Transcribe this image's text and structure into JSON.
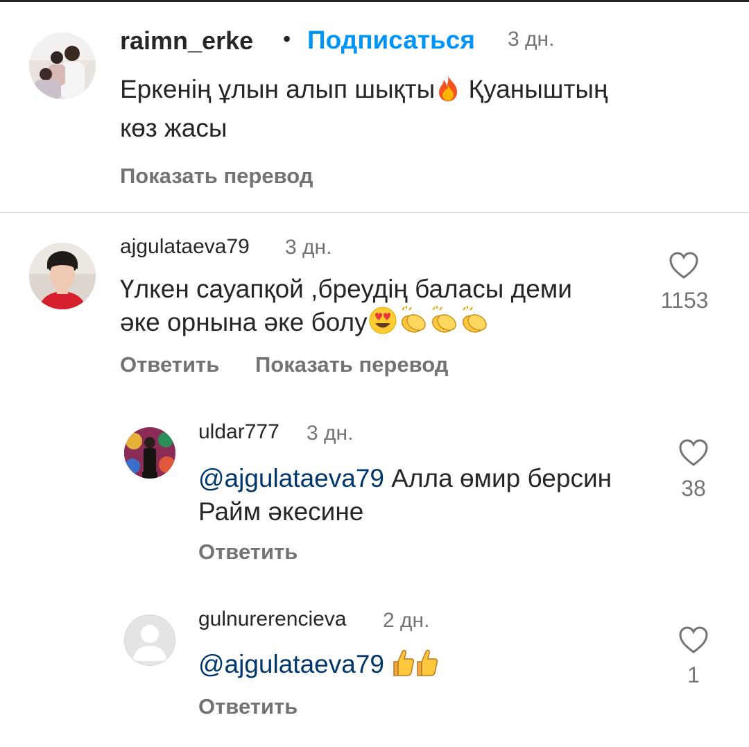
{
  "comment_main": {
    "username": "raimn_erke",
    "dot": "•",
    "follow_label": "Подписаться",
    "time": "3 дн.",
    "text_line1": "Еркенің ұлын алып шықты",
    "text_line1_end": " Қуаныштың",
    "text_line2": "көз жасы",
    "translate_label": "Показать перевод",
    "emoji": "fire-emoji"
  },
  "comment_1": {
    "username": "ajgulataeva79",
    "time": "3 дн.",
    "text_line1": "Үлкен сауапқой ,бреудің баласы деми",
    "text_line2": "әке орнына әке болу",
    "reply_label": "Ответить",
    "translate_label": "Показать перевод",
    "like_count": "1153",
    "emojis": [
      "heart-eyes-emoji",
      "clapping-emoji",
      "clapping-emoji",
      "clapping-emoji"
    ]
  },
  "reply_1": {
    "username": "uldar777",
    "time": "3 дн.",
    "mention": "@ajgulataeva79",
    "text_line1": " Алла  өмир  берсин",
    "text_line2": "Райм  әкесине",
    "reply_label": "Ответить",
    "like_count": "38"
  },
  "reply_2": {
    "username": "gulnurerencieva",
    "time": "2 дн.",
    "mention": "@ajgulataeva79",
    "reply_label": "Ответить",
    "like_count": "1",
    "emojis": [
      "thumbs-up-emoji",
      "thumbs-up-emoji"
    ]
  },
  "colors": {
    "link_blue": "#0095f6",
    "mention_blue": "#00376b",
    "muted_gray": "#737373",
    "text": "#262626"
  }
}
